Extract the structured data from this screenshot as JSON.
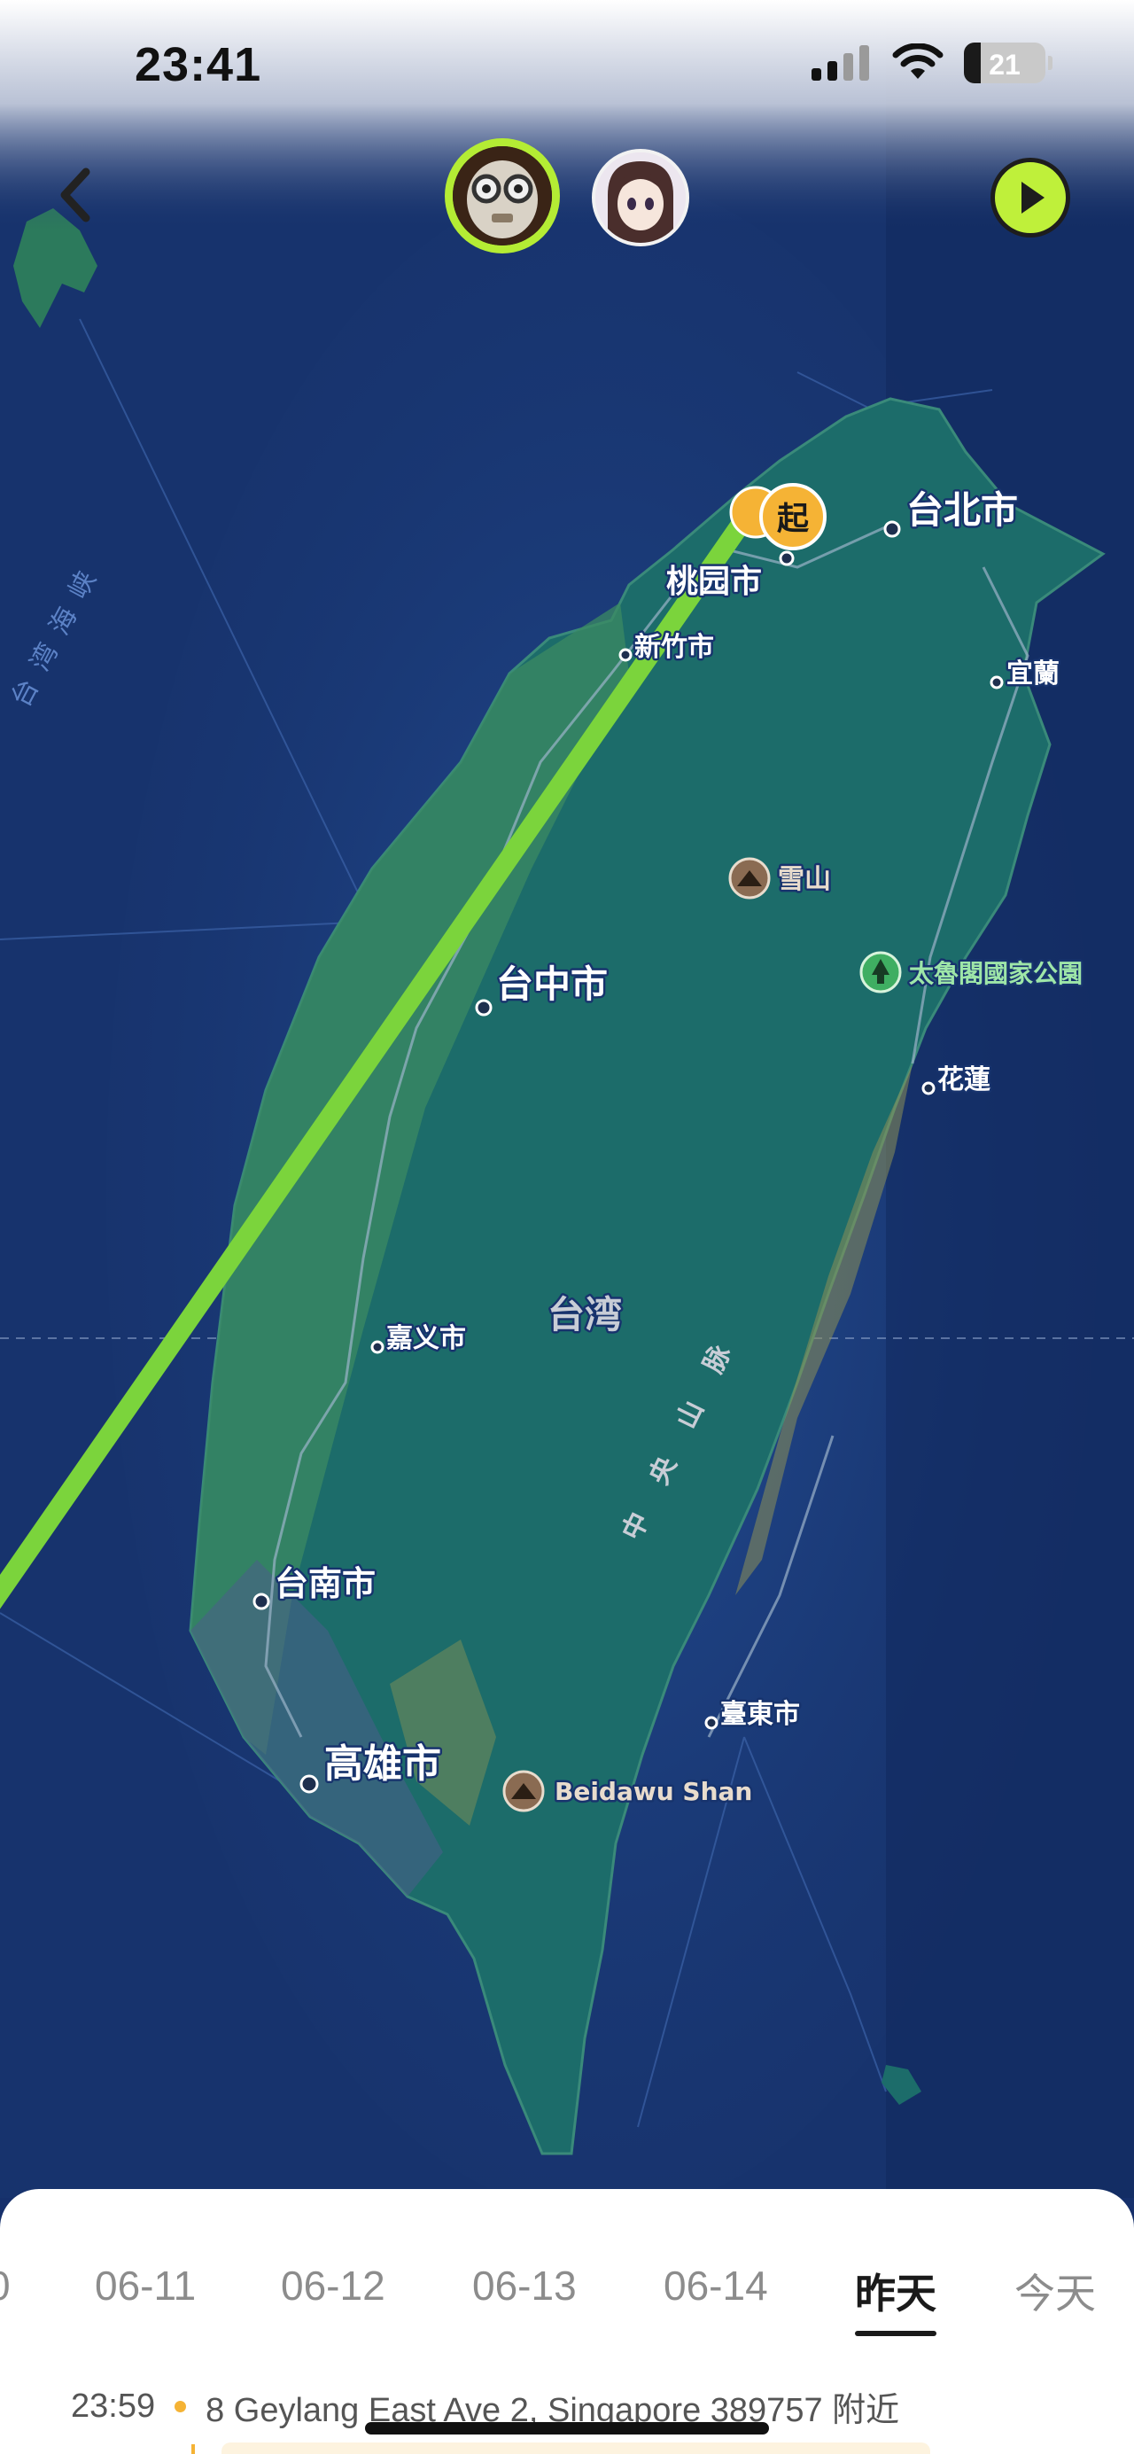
{
  "status_bar": {
    "time": "23:41",
    "battery_level": "21",
    "battery_fraction": 0.21
  },
  "map": {
    "labels": {
      "taipei": "台北市",
      "taoyuan": "桃园市",
      "hsinchu": "新竹市",
      "yilan": "宜蘭",
      "snow_mountain": "雪山",
      "taroko": "太魯閣國家公園",
      "taichung": "台中市",
      "hualien": "花蓮",
      "taiwan": "台湾",
      "central_range": "中央山脉",
      "chiayi": "嘉义市",
      "tainan": "台南市",
      "taitung": "臺東市",
      "kaohsiung": "高雄市",
      "beidawu": "Beidawu Shan",
      "strait": "台湾海峡"
    },
    "start_marker": "起",
    "colors": {
      "ocean": "#17336d",
      "land": "#1c6c6a",
      "route": "#7bd43c",
      "marker": "#f5b335"
    },
    "icons": {
      "mountain": "mountain-icon",
      "park": "tree-icon"
    }
  },
  "date_tabs": [
    {
      "label": "0",
      "active": false
    },
    {
      "label": "06-11",
      "active": false
    },
    {
      "label": "06-12",
      "active": false
    },
    {
      "label": "06-13",
      "active": false
    },
    {
      "label": "06-14",
      "active": false
    },
    {
      "label": "昨天",
      "active": true
    },
    {
      "label": "今天",
      "active": false
    }
  ],
  "location_entry": {
    "time": "23:59",
    "address": "8 Geylang East Ave 2, Singapore 389757 附近"
  }
}
